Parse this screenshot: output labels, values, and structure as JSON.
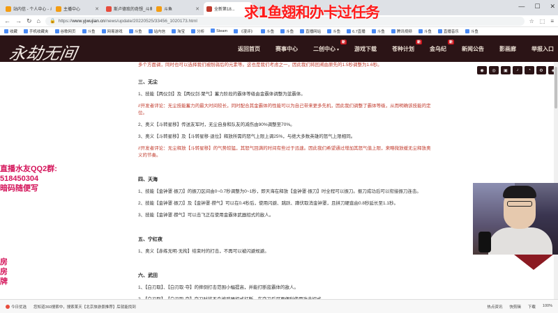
{
  "browser": {
    "tabs": [
      {
        "label": "站内信 - 个人中心 - 斗鱼",
        "color": "#f39c12",
        "active": false
      },
      {
        "label": "主播中心",
        "color": "#f39c12",
        "active": false
      },
      {
        "label": "斯卢德玫的奇想_斗鱼首页",
        "color": "#e74c3c",
        "active": false
      },
      {
        "label": "斗鱼",
        "color": "#f39c12",
        "active": false
      },
      {
        "label": "全新第18...",
        "color": "#c0392b",
        "active": true
      }
    ],
    "newtab": "+",
    "url_host": "www.yjwujian.cn",
    "url_path": "/news/update/20220525/33456_1020173.html",
    "url_scheme": "https://",
    "bookmarks": [
      "收藏",
      "手机收藏夹",
      "谷歌网页",
      "斗鱼",
      "网易游戏",
      "斗鱼",
      "站内信",
      "淘宝",
      "分析",
      "Steam",
      "《漫评》",
      "斗鱼",
      "斗鱼",
      "直播网站",
      "斗鱼",
      "6.7直播",
      "斗鱼",
      "腾讯视频",
      "斗鱼",
      "直播音乐",
      "斗鱼"
    ]
  },
  "site": {
    "logo": "永劫无间",
    "nav": [
      {
        "label": "返回首页",
        "new": false,
        "dropdown": false
      },
      {
        "label": "赛事中心",
        "new": false,
        "dropdown": false
      },
      {
        "label": "二创中心",
        "new": true,
        "dropdown": true
      },
      {
        "label": "游戏下载",
        "new": false,
        "dropdown": false
      },
      {
        "label": "苍种计划",
        "new": true,
        "dropdown": false
      },
      {
        "label": "金乌纪",
        "new": true,
        "dropdown": false
      },
      {
        "label": "新闻公告",
        "new": false,
        "dropdown": false
      },
      {
        "label": "影画廊",
        "new": false,
        "dropdown": false
      },
      {
        "label": "举报入口",
        "new": false,
        "dropdown": false
      }
    ],
    "new_badge": "新",
    "social_icons": [
      "wechat-icon",
      "weibo-icon",
      "bilibili-icon",
      "douyin-icon",
      "qq-icon",
      "steam-icon",
      "netease-icon"
    ]
  },
  "article": {
    "top_red_line": "多个方面调，同时也可以选择我们被削弱后的元素等。这也是我们考虑之一，因此我们将回溯由原先的1.5秒调整为1.6秒。",
    "sections": [
      {
        "title": "三、无尘",
        "items": [
          {
            "type": "para",
            "text": "1、技能【两仪剑】及【两仪剑·聚气】蓄力阶段的霸体等级由金霸体调整为蓝霸体。"
          },
          {
            "type": "dev",
            "text": "//开发者评论：无尘技能蓄力的最大时间较长，同时配合其金霸体的性能可以为自己带来更多先机，因此我们调整了霸体等级，从而明确该技能的定位。"
          },
          {
            "type": "para",
            "text": "2、奥义【斗转星移】传送友军时，无尘自身和队友的减伤由90%调整至70%。"
          },
          {
            "type": "para",
            "text": "3、奥义【斗转星移】及【斗转星移·退位】释放所需的怒气上限上调25%，与绝大多数英雄的怒气上限相同。"
          },
          {
            "type": "dev",
            "text": "//开发者评论：无尘释放【斗转星移】的气势较猛，其怒气回满的时间有些过于迅速。因此我们希望通过增加其怒气值上限，来略微放缓无尘释放奥义的节奏。"
          }
        ]
      },
      {
        "title": "四、天海",
        "items": [
          {
            "type": "para",
            "text": "1、技能【金钟罩·振刀】的振刀区间由0~0.7秒调整为0~1秒，即天海在释放【金钟罩·振刀】时全程可以振刀。振刀成功后可以衔接振刀连击。"
          },
          {
            "type": "para",
            "text": "2、技能【金钟罩·振刀】及【金钟罩·攒气】可以在0.4秒后，使用闪避、跳跃、蹲伏取消金钟罩，且拼刀硬直由0.8秒延长至1.1秒。"
          },
          {
            "type": "para",
            "text": "3、技能【金钟罩·攒气】可以击飞正在使用金霸体武器招式的敌人。"
          }
        ]
      },
      {
        "title": "五、宁红夜",
        "items": [
          {
            "type": "para",
            "text": "1、奥义【赤练无明·无拘】结束时的打击，不再可以被闪避规避。"
          }
        ]
      },
      {
        "title": "六、武田",
        "items": [
          {
            "type": "para",
            "text": "1、【白刃取】、【白刃取·夺】的摔倒打击范围小幅提高，并能打断蓝霸体的敌人。"
          },
          {
            "type": "para",
            "text": "2、【白刃取】、【白刃取·夺】夺刀时将不会被武器招式打断，在夺刀后可更便利使用攻击招式。"
          }
        ]
      }
    ]
  },
  "stream_overlay": {
    "top_banner": "求1鱼翅和办卡过任务",
    "left_lines": [
      "直播水友QQ2群:",
      "518450304",
      "暗码随便写"
    ],
    "bottom_lines": [
      "房",
      "房",
      "牌"
    ]
  },
  "statusbar": {
    "left": "今日优选",
    "notice": "您知道360搜索中，搜索某天【北京旅游景推荐】后就能找到",
    "right": [
      "热点资讯",
      "快剪辑",
      "下载",
      "100%"
    ]
  }
}
